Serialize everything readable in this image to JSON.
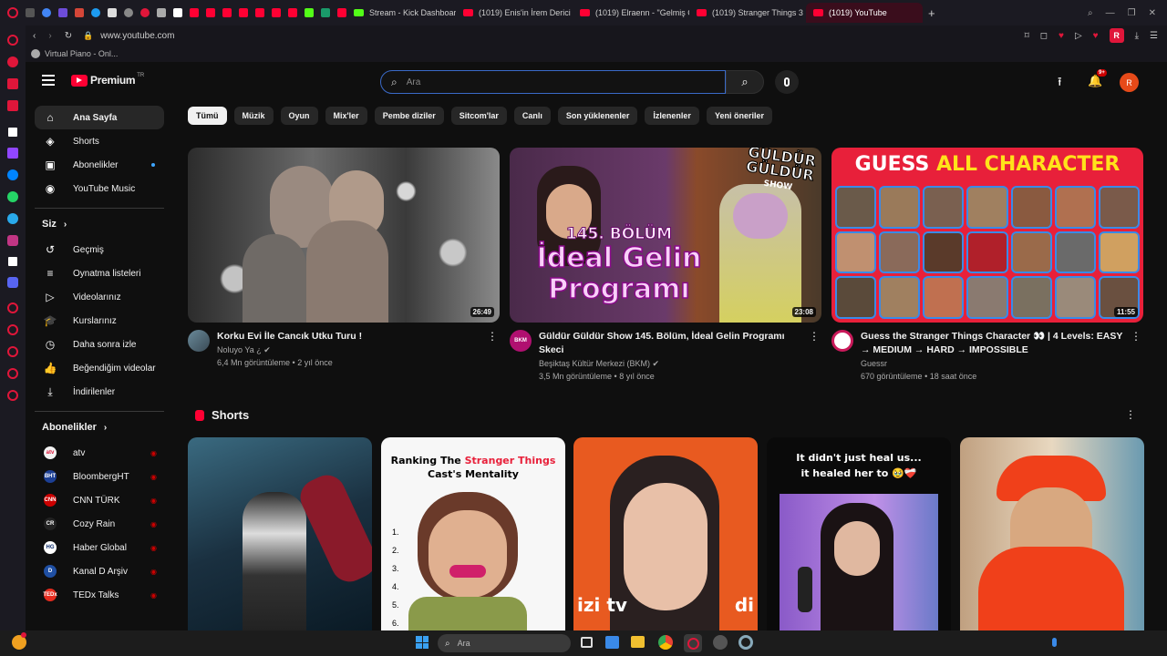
{
  "browser": {
    "tabs": [
      {
        "label": "Stream - Kick Dashboard"
      },
      {
        "label": "(1019) Enis'in İrem Derici"
      },
      {
        "label": "(1019) Elraenn - \"Gelmiş G"
      },
      {
        "label": "(1019) Stranger Things 3"
      },
      {
        "label": "(1019) YouTube"
      }
    ],
    "url": "www.youtube.com",
    "bookmark": "Virtual Piano - Onl...",
    "profile_initial": "R"
  },
  "youtube": {
    "logo_text": "Premium",
    "logo_region": "TR",
    "search_placeholder": "Ara",
    "notifications_badge": "9+",
    "avatar_initial": "R",
    "sidebar": {
      "main": [
        {
          "label": "Ana Sayfa",
          "icon": "home-icon"
        },
        {
          "label": "Shorts",
          "icon": "shorts-icon"
        },
        {
          "label": "Abonelikler",
          "icon": "subscriptions-icon"
        },
        {
          "label": "YouTube Music",
          "icon": "music-icon"
        }
      ],
      "you_header": "Siz",
      "you": [
        {
          "label": "Geçmiş",
          "icon": "history-icon"
        },
        {
          "label": "Oynatma listeleri",
          "icon": "playlist-icon"
        },
        {
          "label": "Videolarınız",
          "icon": "videos-icon"
        },
        {
          "label": "Kurslarınız",
          "icon": "courses-icon"
        },
        {
          "label": "Daha sonra izle",
          "icon": "watch-later-icon"
        },
        {
          "label": "Beğendiğim videolar",
          "icon": "like-icon"
        },
        {
          "label": "İndirilenler",
          "icon": "download-icon"
        }
      ],
      "subs_header": "Abonelikler",
      "subs": [
        {
          "label": "atv",
          "avatar": "atv",
          "color": "#f2f2f2"
        },
        {
          "label": "BloombergHT",
          "avatar": "BHT",
          "color": "#1c3f94"
        },
        {
          "label": "CNN TÜRK",
          "avatar": "CNN",
          "color": "#cc0000"
        },
        {
          "label": "Cozy Rain",
          "avatar": "CR",
          "color": "#222222"
        },
        {
          "label": "Haber Global",
          "avatar": "HG",
          "color": "#ffffff"
        },
        {
          "label": "Kanal D Arşiv",
          "avatar": "D",
          "color": "#1f4fa3"
        },
        {
          "label": "TEDx Talks",
          "avatar": "TEDx",
          "color": "#e62b1e"
        }
      ]
    },
    "chips": [
      "Tümü",
      "Müzik",
      "Oyun",
      "Mix'ler",
      "Pembe diziler",
      "Sitcom'lar",
      "Canlı",
      "Son yüklenenler",
      "İzlenenler",
      "Yeni öneriler"
    ],
    "videos": [
      {
        "title": "Korku Evi İle Cancık Utku Turu !",
        "channel": "Noluyo Ya ¿",
        "views": "6,4 Mn görüntüleme",
        "age": "2 yıl önce",
        "duration": "26:49"
      },
      {
        "title": "Güldür Güldür Show 145. Bölüm, İdeal Gelin Programı Skeci",
        "channel": "Beşiktaş Kültür Merkezi (BKM)",
        "views": "3,5 Mn görüntüleme",
        "age": "8 yıl önce",
        "duration": "23:08",
        "thumb_lines": [
          "145. BÖLÜM",
          "İdeal Gelin",
          "Programı"
        ],
        "thumb_logo": [
          "GÜLDÜR",
          "GÜLDÜR",
          "SHOW"
        ],
        "avatar": "BKM"
      },
      {
        "title": "Guess the Stranger Things Character 👀 | 4 Levels: EASY → MEDIUM → HARD → IMPOSSIBLE",
        "channel": "Guessr",
        "views": "670 görüntüleme",
        "age": "18 saat önce",
        "duration": "11:55",
        "thumb_head_a": "GUESS ",
        "thumb_head_b": "ALL CHARACTER"
      }
    ],
    "shorts_header": "Shorts",
    "shorts": [
      {
        "title": ""
      },
      {
        "caption_a": "Ranking The ",
        "caption_b": "Stranger Things",
        "caption_c": "Cast's Mentality",
        "list": [
          "1.",
          "2.",
          "3.",
          "4.",
          "5.",
          "6."
        ]
      },
      {
        "caption": "izi tv",
        "caption_b": "di"
      },
      {
        "caption_a": "It didn't just heal us...",
        "caption_b": "it healed her to 🥹❤️‍🩹"
      },
      {
        "title": ""
      }
    ]
  },
  "taskbar": {
    "search_placeholder": "Ara"
  }
}
